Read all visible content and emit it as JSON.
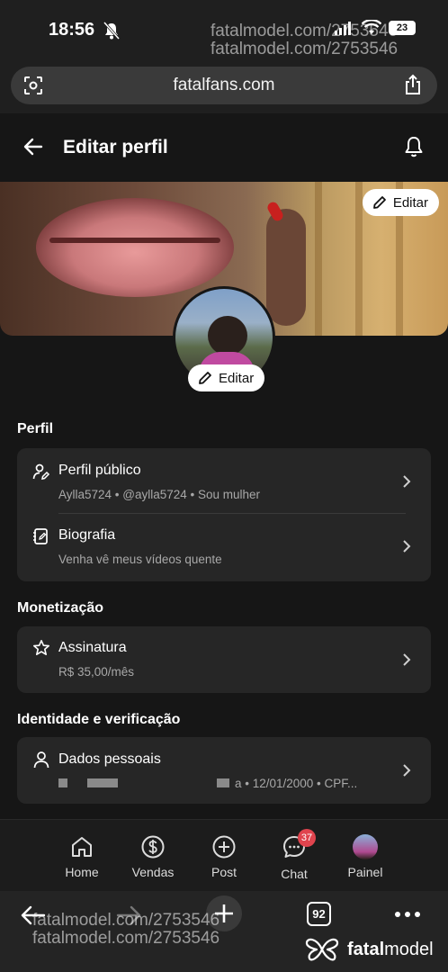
{
  "status_bar": {
    "time": "18:56",
    "battery": "23"
  },
  "watermark": {
    "text": "fatalmodel.com/2753546"
  },
  "browser": {
    "url": "fatalfans.com",
    "tabs_count": "92"
  },
  "header": {
    "title": "Editar perfil"
  },
  "cover": {
    "edit_label": "Editar"
  },
  "avatar": {
    "edit_label": "Editar"
  },
  "sections": {
    "perfil": {
      "title": "Perfil",
      "public_profile": {
        "label": "Perfil público",
        "sub": "Aylla5724 • @aylla5724 • Sou mulher"
      },
      "bio": {
        "label": "Biografia",
        "sub": "Venha vê meus vídeos quente"
      }
    },
    "monetizacao": {
      "title": "Monetização",
      "subscription": {
        "label": "Assinatura",
        "sub": "R$ 35,00/mês"
      }
    },
    "identidade": {
      "title": "Identidade e verificação",
      "personal": {
        "label": "Dados pessoais",
        "sub": "a • 12/01/2000 • CPF..."
      }
    }
  },
  "bottom_nav": {
    "home": "Home",
    "sales": "Vendas",
    "post": "Post",
    "chat": "Chat",
    "chat_badge": "37",
    "panel": "Painel"
  },
  "brand": {
    "name_bold": "fatal",
    "name_rest": "model"
  },
  "colors": {
    "background": "#161616",
    "card": "#262626",
    "badge": "#e0444e",
    "accent_nail": "#c8201e"
  }
}
